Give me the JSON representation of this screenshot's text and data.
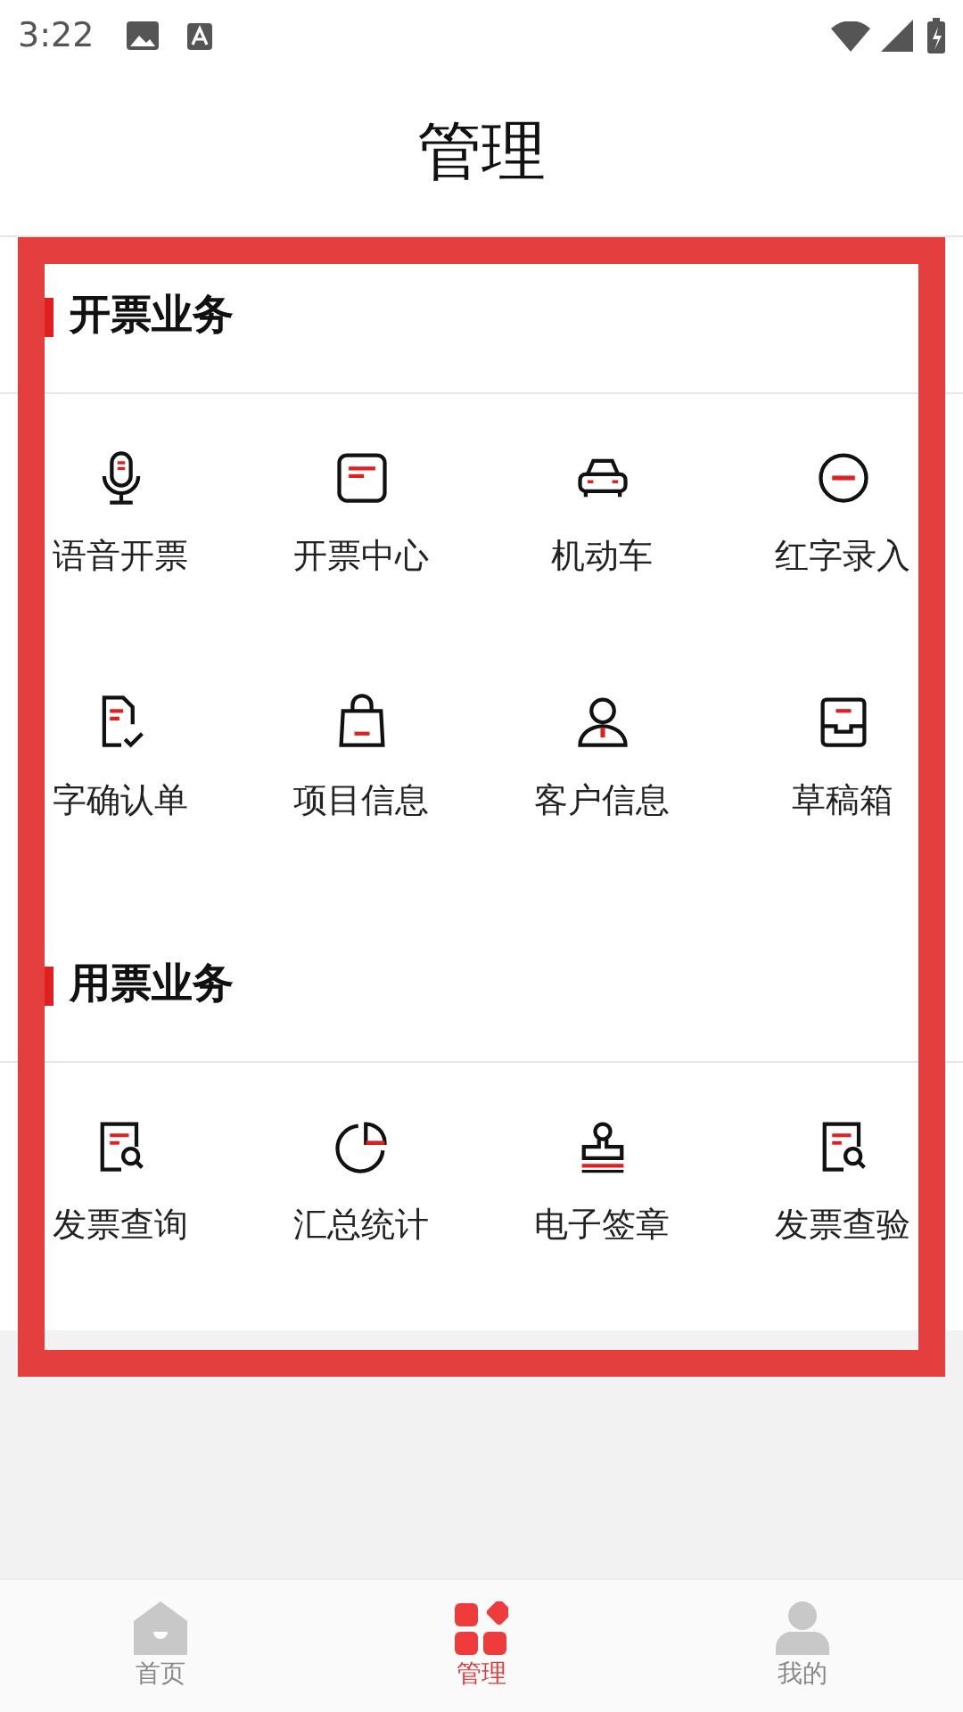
{
  "status_bar": {
    "time": "3:22"
  },
  "header": {
    "title": "管理"
  },
  "sections": [
    {
      "title": "开票业务",
      "items": [
        {
          "label": "语音开票",
          "kind": "mic"
        },
        {
          "label": "开票中心",
          "kind": "square"
        },
        {
          "label": "机动车",
          "kind": "car"
        },
        {
          "label": "红字录入",
          "kind": "minus"
        },
        {
          "label": "字确认单",
          "kind": "doccheck"
        },
        {
          "label": "项目信息",
          "kind": "bag"
        },
        {
          "label": "客户信息",
          "kind": "person"
        },
        {
          "label": "草稿箱",
          "kind": "inbox"
        }
      ]
    },
    {
      "title": "用票业务",
      "items": [
        {
          "label": "发票查询",
          "kind": "docsearch"
        },
        {
          "label": "汇总统计",
          "kind": "pie"
        },
        {
          "label": "电子签章",
          "kind": "stamp"
        },
        {
          "label": "发票查验",
          "kind": "docsearch"
        }
      ]
    }
  ],
  "tabs": [
    {
      "label": "首页",
      "kind": "home",
      "selected": false
    },
    {
      "label": "管理",
      "kind": "grid",
      "selected": true
    },
    {
      "label": "我的",
      "kind": "user",
      "selected": false
    }
  ]
}
